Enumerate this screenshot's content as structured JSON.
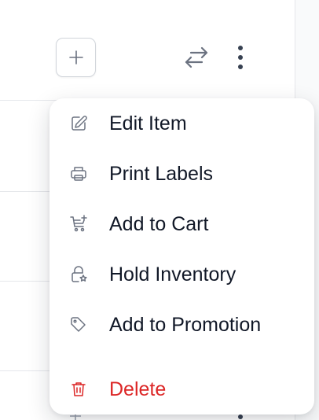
{
  "toolbar": {
    "add_icon": "plus-icon",
    "swap_icon": "arrows-swap-icon",
    "more_icon": "vertical-dots-icon"
  },
  "menu": {
    "items": [
      {
        "label": "Edit Item",
        "icon": "pencil-icon"
      },
      {
        "label": "Print Labels",
        "icon": "printer-icon"
      },
      {
        "label": "Add to Cart",
        "icon": "cart-add-icon"
      },
      {
        "label": "Hold Inventory",
        "icon": "lock-star-icon"
      },
      {
        "label": "Add to Promotion",
        "icon": "tag-icon"
      }
    ],
    "delete": {
      "label": "Delete",
      "icon": "trash-icon"
    }
  },
  "colors": {
    "text": "#111827",
    "icon": "#6b7280",
    "danger": "#dc2626",
    "border": "#e5e7eb"
  }
}
